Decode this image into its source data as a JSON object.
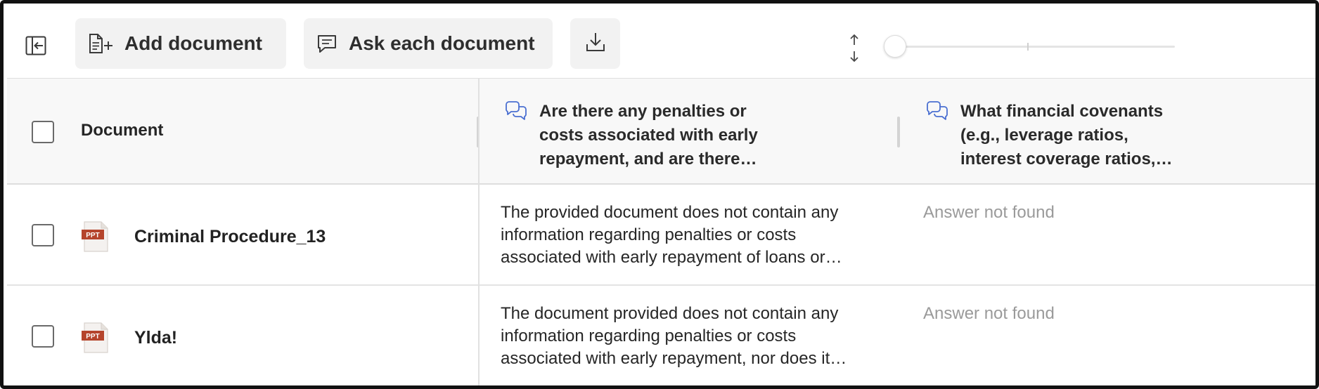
{
  "toolbar": {
    "sidebar_toggle_icon": "sidebar-collapse-icon",
    "add_document_label": "Add document",
    "add_document_icon": "document-add-icon",
    "ask_each_label": "Ask each document",
    "ask_each_icon": "chat-icon",
    "download_icon": "download-icon",
    "density_icon": "vertical-resize-icon",
    "slider_value": 0
  },
  "table": {
    "header": {
      "document_label": "Document",
      "questions": [
        {
          "icon": "chat-bubbles-icon",
          "text": "Are there any penalties or costs associated with early repayment, and are there…"
        },
        {
          "icon": "chat-bubbles-icon",
          "text": "What financial covenants (e.g., leverage ratios, interest coverage ratios,…"
        }
      ]
    },
    "rows": [
      {
        "file_icon": "ppt-file-icon",
        "file_badge": "PPT",
        "name": "Criminal Procedure_13",
        "answers": [
          "The provided document does not contain any information regarding penalties or costs associated with early repayment of loans or…",
          "Answer not found"
        ]
      },
      {
        "file_icon": "ppt-file-icon",
        "file_badge": "PPT",
        "name": "Ylda!",
        "answers": [
          "The document provided does not contain any information regarding penalties or costs associated with early repayment, nor does it…",
          "Answer not found"
        ]
      }
    ]
  },
  "colors": {
    "accent_icon": "#4a6fd1",
    "ppt_red": "#b5442c",
    "muted_text": "#9a9a9a",
    "button_bg": "#f2f2f2"
  }
}
